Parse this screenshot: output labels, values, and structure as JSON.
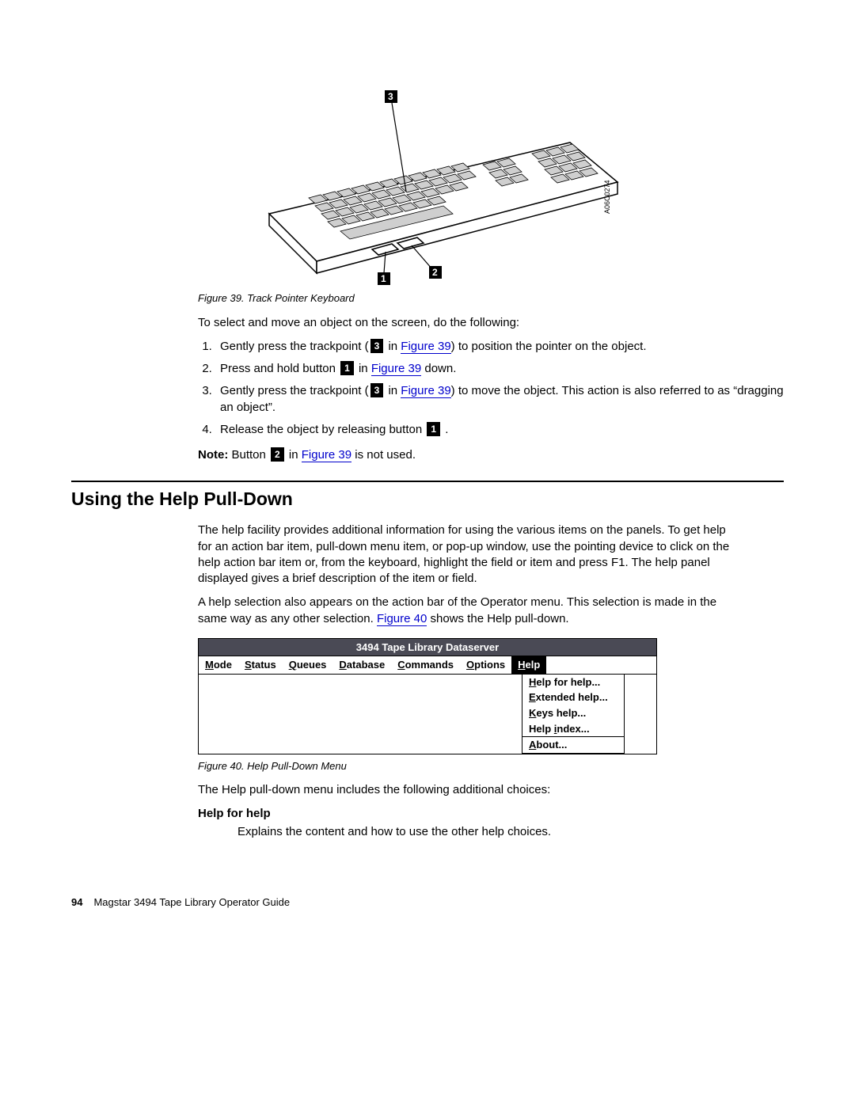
{
  "figure39": {
    "caption": "Figure 39. Track Pointer Keyboard",
    "callouts": {
      "c1": "1",
      "c2": "2",
      "c3": "3"
    },
    "drawing_id": "A06C0274"
  },
  "intro": "To select and move an object on the screen, do the following:",
  "steps": {
    "s1a": "Gently press the trackpoint (",
    "s1b": " in ",
    "s1c": ") to position the pointer on the object.",
    "s2a": "Press and hold button ",
    "s2b": " in ",
    "s2c": " down.",
    "s3a": "Gently press the trackpoint (",
    "s3b": " in ",
    "s3c": ") to move the object. This action is also referred to as “dragging an object”.",
    "s4a": "Release the object by releasing button ",
    "s4b": " ."
  },
  "figref39": "Figure 39",
  "note": {
    "label": "Note:",
    "a": " Button ",
    "b": " in ",
    "c": " is not used."
  },
  "section_heading": "Using the Help Pull-Down",
  "para1": "The help facility provides additional information for using the various items on the panels. To get help for an action bar item, pull-down menu item, or pop-up window, use the pointing device to click on the help action bar item or, from the keyboard, highlight the field or item and press F1. The help panel displayed gives a brief description of the item or field.",
  "para2a": "A help selection also appears on the action bar of the Operator menu. This selection is made in the same way as any other selection. ",
  "para2b": " shows the Help pull-down.",
  "figref40": "Figure 40",
  "menu": {
    "title": "3494 Tape Library Dataserver",
    "items": [
      {
        "full": "Mode",
        "mn": "M",
        "rest": "ode"
      },
      {
        "full": "Status",
        "mn": "S",
        "rest": "tatus"
      },
      {
        "full": "Queues",
        "mn": "Q",
        "rest": "ueues"
      },
      {
        "full": "Database",
        "mn": "D",
        "rest": "atabase"
      },
      {
        "full": "Commands",
        "mn": "C",
        "rest": "ommands"
      },
      {
        "full": "Options",
        "mn": "O",
        "rest": "ptions"
      },
      {
        "full": "Help",
        "mn": "H",
        "rest": "elp",
        "selected": true
      }
    ],
    "dropdown": [
      {
        "mn": "H",
        "rest": "elp for help..."
      },
      {
        "mn": "E",
        "rest": "xtended help..."
      },
      {
        "mn": "K",
        "rest": "eys help..."
      },
      {
        "pre": "Help ",
        "mn": "i",
        "rest": "ndex..."
      },
      {
        "sep": true
      },
      {
        "mn": "A",
        "rest": "bout..."
      }
    ]
  },
  "figure40": {
    "caption": "Figure 40. Help Pull-Down Menu"
  },
  "after_menu": "The Help pull-down menu includes the following additional choices:",
  "dl": {
    "term1": "Help for help",
    "def1": "Explains the content and how to use the other help choices."
  },
  "footer": {
    "page": "94",
    "book": "Magstar 3494 Tape Library Operator Guide"
  }
}
